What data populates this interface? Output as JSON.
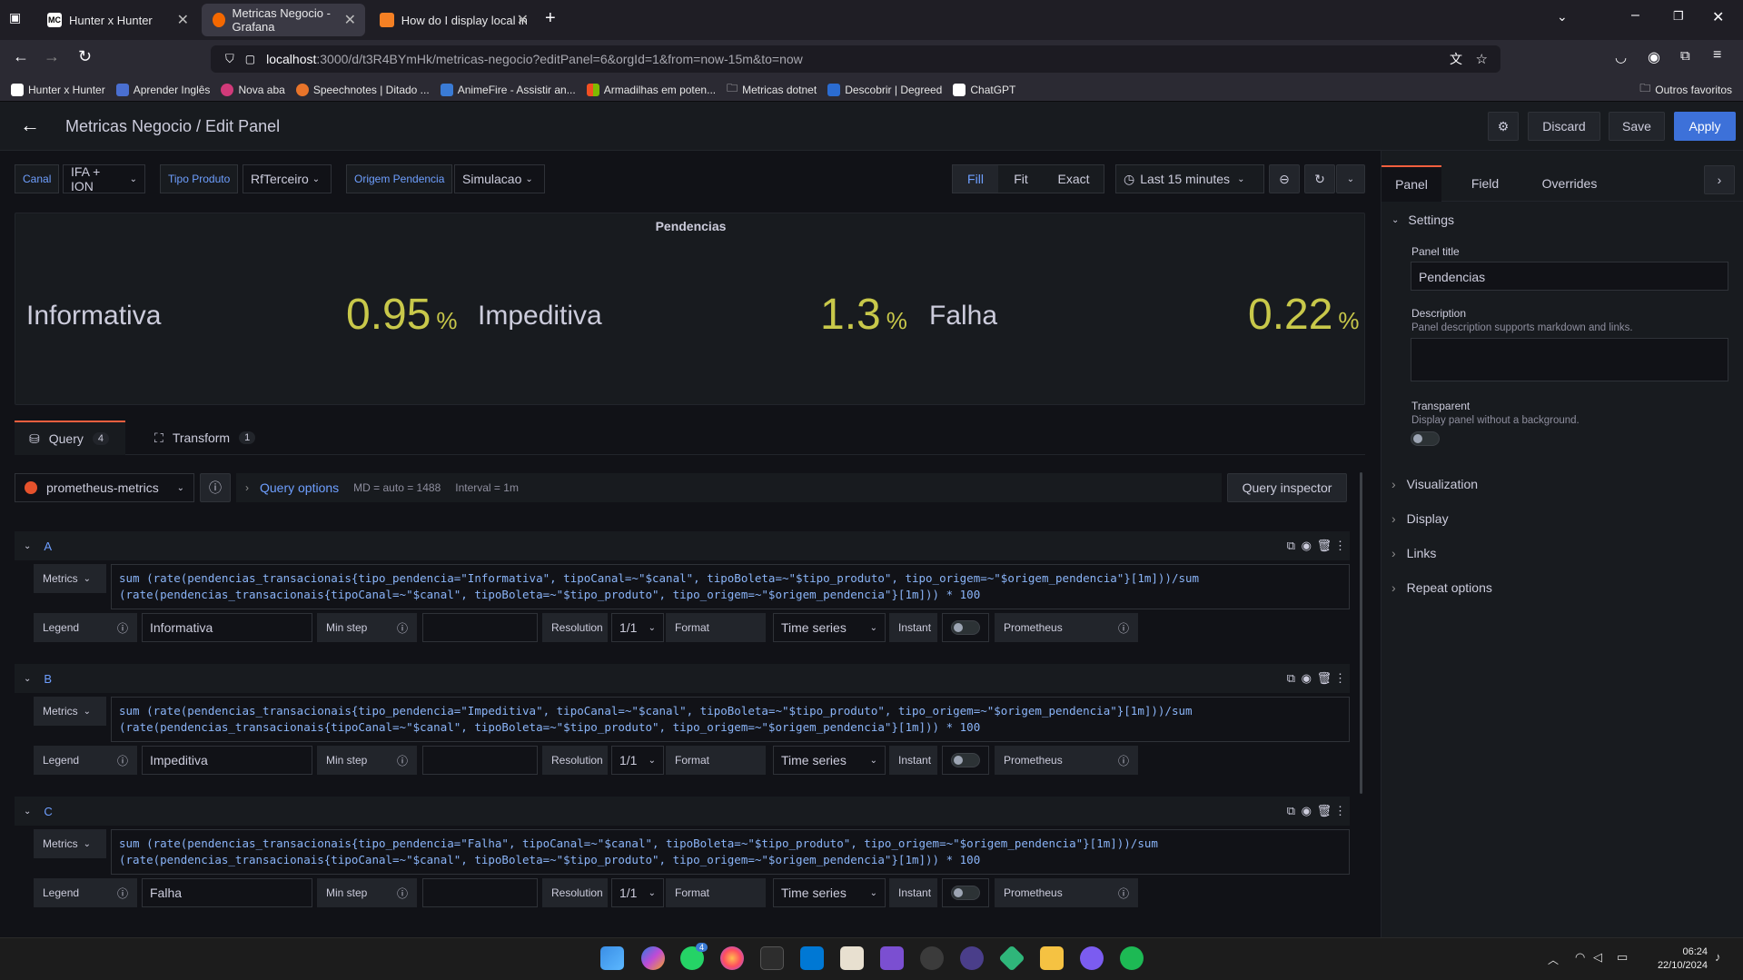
{
  "browser": {
    "tabs": [
      {
        "title": "Hunter x Hunter",
        "icon": "MC"
      },
      {
        "title": "Metricas Negocio - Grafana",
        "icon": "grafana"
      },
      {
        "title": "How do I display local image in",
        "icon": "stackoverflow"
      }
    ],
    "url_host": "localhost",
    "url_rest": ":3000/d/t3R4BYmHk/metricas-negocio?editPanel=6&orgId=1&from=now-15m&to=now",
    "bookmarks": [
      "Hunter x Hunter",
      "Aprender Inglês",
      "Nova aba",
      "Speechnotes | Ditado ...",
      "AnimeFire - Assistir an...",
      "Armadilhas em poten...",
      "Metricas dotnet",
      "Descobrir | Degreed",
      "ChatGPT"
    ],
    "other_bookmarks": "Outros favoritos"
  },
  "header": {
    "title": "Metricas Negocio / Edit Panel",
    "discard": "Discard",
    "save": "Save",
    "apply": "Apply"
  },
  "variables": [
    {
      "label": "Canal",
      "value": "IFA + ION"
    },
    {
      "label": "Tipo Produto",
      "value": "RfTerceiro"
    },
    {
      "label": "Origem Pendencia",
      "value": "Simulacao"
    }
  ],
  "view_modes": [
    "Fill",
    "Fit",
    "Exact"
  ],
  "time_range": "Last 15 minutes",
  "panel": {
    "title": "Pendencias",
    "stats": [
      {
        "name": "Informativa",
        "value": "0.95",
        "unit": "%"
      },
      {
        "name": "Impeditiva",
        "value": "1.3",
        "unit": "%"
      },
      {
        "name": "Falha",
        "value": "0.22",
        "unit": "%"
      }
    ]
  },
  "editor_tabs": [
    {
      "label": "Query",
      "count": "4"
    },
    {
      "label": "Transform",
      "count": "1"
    }
  ],
  "datasource": "prometheus-metrics",
  "query_options": {
    "label": "Query options",
    "md": "MD = auto = 1488",
    "interval": "Interval = 1m"
  },
  "query_inspector": "Query inspector",
  "queries": [
    {
      "ref": "A",
      "line1": "sum (rate(pendencias_transacionais{tipo_pendencia=\"Informativa\", tipoCanal=~\"$canal\", tipoBoleta=~\"$tipo_produto\", tipo_origem=~\"$origem_pendencia\"}[1m]))/sum",
      "line2": "(rate(pendencias_transacionais{tipoCanal=~\"$canal\", tipoBoleta=~\"$tipo_produto\", tipo_origem=~\"$origem_pendencia\"}[1m])) * 100",
      "legend": "Informativa"
    },
    {
      "ref": "B",
      "line1": "sum (rate(pendencias_transacionais{tipo_pendencia=\"Impeditiva\", tipoCanal=~\"$canal\", tipoBoleta=~\"$tipo_produto\", tipo_origem=~\"$origem_pendencia\"}[1m]))/sum",
      "line2": "(rate(pendencias_transacionais{tipoCanal=~\"$canal\", tipoBoleta=~\"$tipo_produto\", tipo_origem=~\"$origem_pendencia\"}[1m])) * 100",
      "legend": "Impeditiva"
    },
    {
      "ref": "C",
      "line1": "sum (rate(pendencias_transacionais{tipo_pendencia=\"Falha\", tipoCanal=~\"$canal\", tipoBoleta=~\"$tipo_produto\", tipo_origem=~\"$origem_pendencia\"}[1m]))/sum",
      "line2": "(rate(pendencias_transacionais{tipoCanal=~\"$canal\", tipoBoleta=~\"$tipo_produto\", tipo_origem=~\"$origem_pendencia\"}[1m])) * 100",
      "legend": "Falha"
    }
  ],
  "query_labels": {
    "metrics": "Metrics",
    "legend": "Legend",
    "min_step": "Min step",
    "resolution": "Resolution",
    "resolution_value": "1/1",
    "format": "Format",
    "format_value": "Time series",
    "instant": "Instant",
    "type": "Prometheus"
  },
  "right_pane": {
    "tabs": [
      "Panel",
      "Field",
      "Overrides"
    ],
    "settings": "Settings",
    "panel_title_label": "Panel title",
    "panel_title_value": "Pendencias",
    "description_label": "Description",
    "description_hint": "Panel description supports markdown and links.",
    "transparent_label": "Transparent",
    "transparent_hint": "Display panel without a background.",
    "sections": [
      "Visualization",
      "Display",
      "Links",
      "Repeat options"
    ]
  },
  "clock": {
    "time": "06:24",
    "date": "22/10/2024"
  },
  "taskbar_badge": "4",
  "colors": {
    "accent": "#3d71d9",
    "stat": "#c8c84a",
    "link": "#6e9fff"
  }
}
